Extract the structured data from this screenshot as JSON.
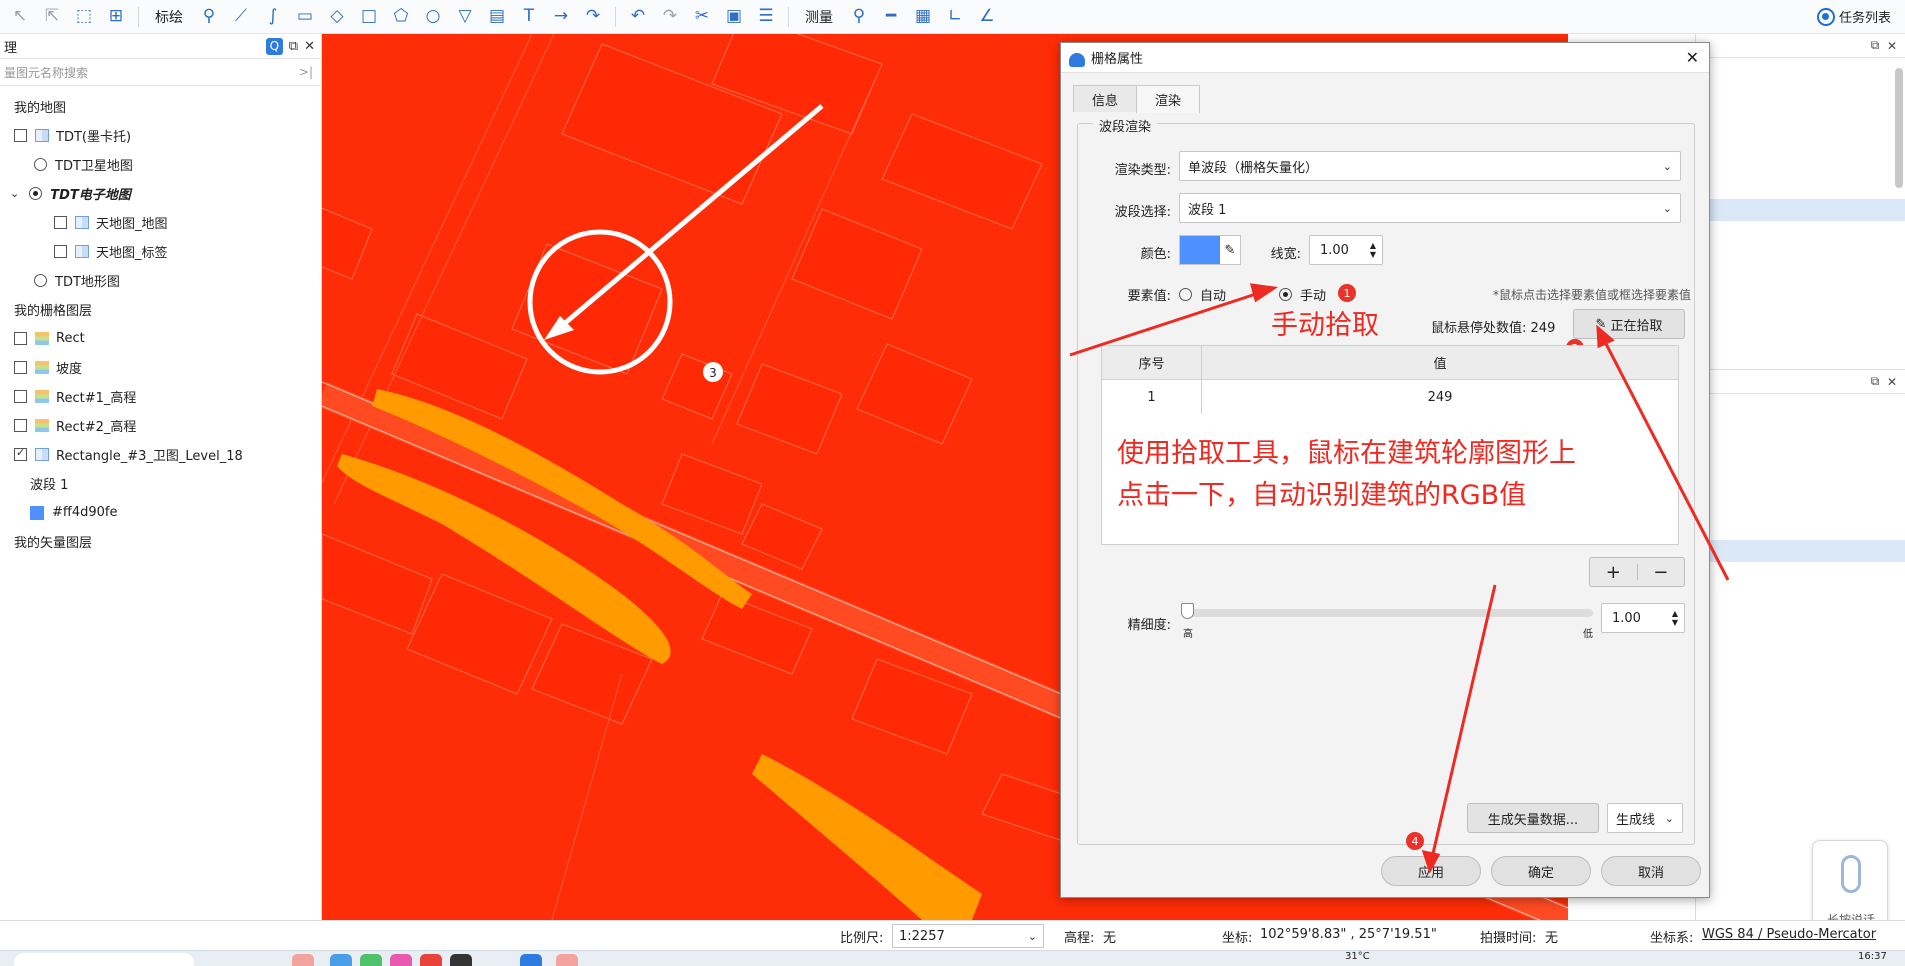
{
  "toolbar": {
    "mark_label": "标绘",
    "measure_label": "测量",
    "task_list_label": "任务列表"
  },
  "layer_panel": {
    "title": "理",
    "search_placeholder": "量图元名称搜索",
    "groups": {
      "my_map": "我的地图",
      "my_raster": "我的栅格图层",
      "my_vector": "我的矢量图层"
    },
    "items": {
      "tdt_mercator": "TDT(墨卡托)",
      "tdt_satellite": "TDT卫星地图",
      "tdt_electronic": "TDT电子地图",
      "tdt_map": "天地图_地图",
      "tdt_label": "天地图_标签",
      "tdt_terrain": "TDT地形图",
      "rect": "Rect",
      "slope": "坡度",
      "rect1": "Rect#1_高程",
      "rect2": "Rect#2_高程",
      "rect3": "Rectangle_#3_卫图_Level_18",
      "band1": "波段 1",
      "color_value": "#ff4d90fe"
    }
  },
  "dialog": {
    "title": "栅格属性",
    "tabs": [
      "信息",
      "渲染"
    ],
    "group_title": "波段渲染",
    "render_type_label": "渲染类型:",
    "render_type_value": "单波段（栅格矢量化）",
    "band_label": "波段选择:",
    "band_value": "波段 1",
    "color_label": "颜色:",
    "color_hex": "#4d90fe",
    "line_width_label": "线宽:",
    "line_width_value": "1.00",
    "element_value_label": "要素值:",
    "auto_label": "自动",
    "manual_label": "手动",
    "hint": "*鼠标点击选择要素值或框选择要素值",
    "hover_value_label": "鼠标悬停处数值:",
    "hover_value": "249",
    "picking_button": "正在拾取",
    "table_headers": [
      "序号",
      "值"
    ],
    "table_rows": [
      [
        "1",
        "249"
      ]
    ],
    "precision_label": "精细度:",
    "precision_high": "高",
    "precision_low": "低",
    "precision_value": "1.00",
    "generate_vector_button": "生成矢量数据...",
    "generate_line_value": "生成线",
    "apply_button": "应用",
    "ok_button": "确定",
    "cancel_button": "取消"
  },
  "annotations": {
    "manual_pick": "手动拾取",
    "instruction_line1": "使用拾取工具，鼠标在建筑轮廓图形上",
    "instruction_line2": "点击一下，自动识别建筑的RGB值",
    "badge1": "1",
    "badge2": "2",
    "badge3": "3",
    "badge4": "4"
  },
  "statusbar": {
    "scale_label": "比例尺:",
    "scale_value": "1:2257",
    "elevation_label": "高程:",
    "elevation_value": "无",
    "coord_label": "坐标:",
    "coord_value": "102°59'8.83\" , 25°7'19.51\"",
    "capture_time_label": "拍摄时间:",
    "capture_time_value": "无",
    "crs_label": "坐标系:",
    "crs_value": "WGS 84 / Pseudo-Mercator"
  },
  "voice_widget": {
    "label": "长按说话"
  },
  "taskbar": {
    "temperature": "31°C",
    "time": "16:37"
  },
  "colors": {
    "map_background": "#ff2d07",
    "road": "#ff8a00",
    "annotation": "#ee2a22",
    "accent": "#2d7be0"
  }
}
